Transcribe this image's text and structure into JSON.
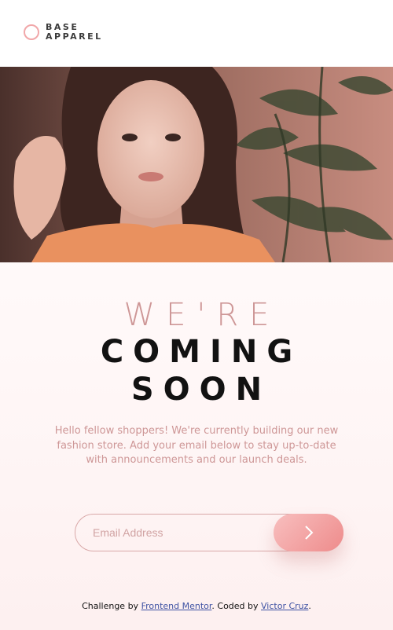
{
  "brand": {
    "line1": "BASE",
    "line2": "APPAREL"
  },
  "heading": {
    "light": "WE'RE",
    "bold_line1": "COMING",
    "bold_line2": "SOON"
  },
  "description": "Hello fellow shoppers! We're currently building our new fashion store. Add your email below to stay up-to-date with announcements and our launch deals.",
  "form": {
    "placeholder": "Email Address",
    "submit_icon": "chevron-right-icon"
  },
  "footer": {
    "prefix": "Challenge by ",
    "link1": "Frontend Mentor",
    "middle": ". Coded by ",
    "link2": "Victor Cruz",
    "suffix": "."
  },
  "colors": {
    "accent": "#ce9797",
    "button_start": "#f8bfbf",
    "button_end": "#ee8b8b",
    "text_dark": "#121212",
    "link": "#3e52a3"
  }
}
